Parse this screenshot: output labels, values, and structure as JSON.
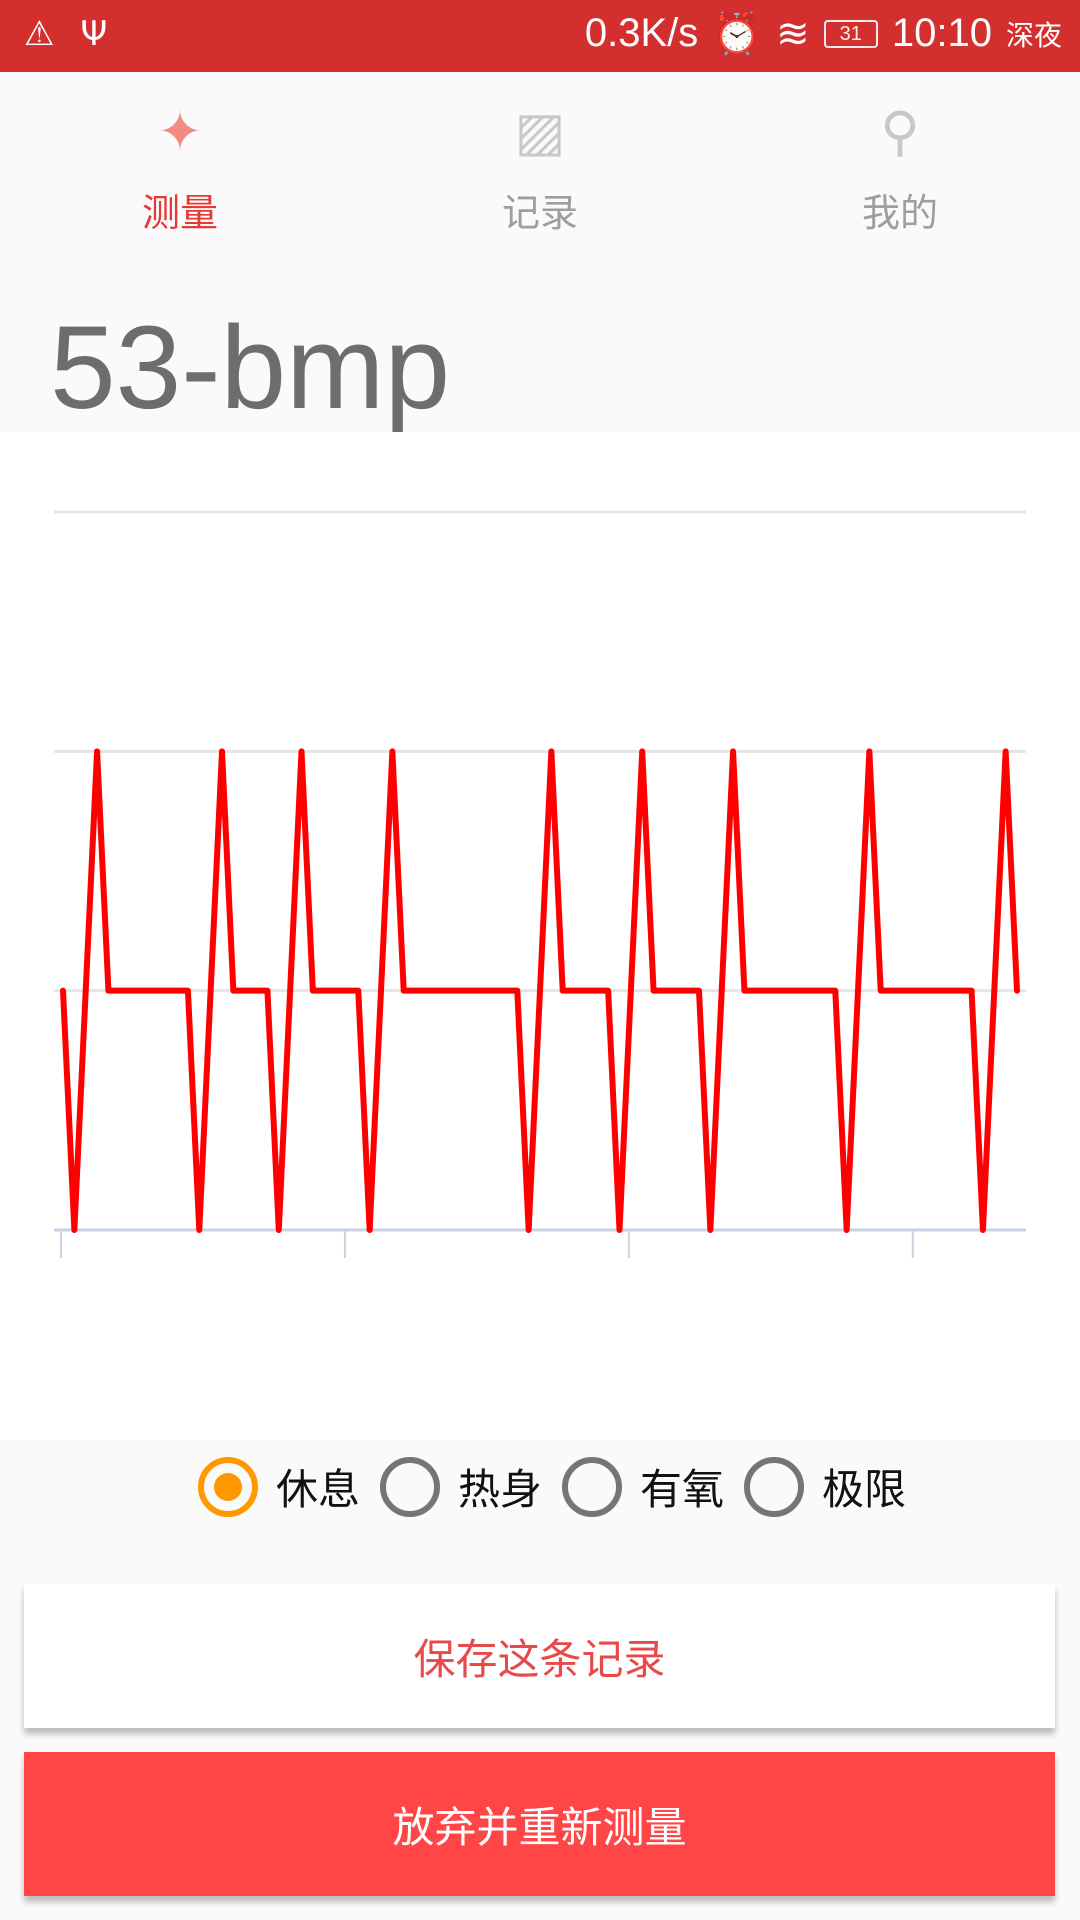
{
  "status_bar": {
    "net_speed": "0.3K/s",
    "battery": "31",
    "time": "10:10",
    "period": "深夜"
  },
  "tabs": [
    {
      "label": "测量",
      "icon": "crosshair-icon"
    },
    {
      "label": "记录",
      "icon": "image-icon"
    },
    {
      "label": "我的",
      "icon": "search-icon"
    }
  ],
  "heart_rate": "53-bmp",
  "chart_data": {
    "type": "line",
    "title": "",
    "xlabel": "",
    "ylabel": "",
    "ylim": [
      0,
      3
    ],
    "xlim": [
      0,
      84
    ],
    "grid": true,
    "x_ticks": [
      0,
      25,
      50,
      75
    ],
    "color": "#ff0000",
    "values": [
      1,
      0,
      1,
      2,
      1,
      1,
      1,
      1,
      1,
      1,
      1,
      1,
      0,
      1,
      2,
      1,
      1,
      1,
      1,
      0,
      1,
      2,
      1,
      1,
      1,
      1,
      1,
      0,
      1,
      2,
      1,
      1,
      1,
      1,
      1,
      1,
      1,
      1,
      1,
      1,
      1,
      0,
      1,
      2,
      1,
      1,
      1,
      1,
      1,
      0,
      1,
      2,
      1,
      1,
      1,
      1,
      1,
      0,
      1,
      2,
      1,
      1,
      1,
      1,
      1,
      1,
      1,
      1,
      1,
      0,
      1,
      2,
      1,
      1,
      1,
      1,
      1,
      1,
      1,
      1,
      1,
      0,
      1,
      2,
      1
    ]
  },
  "modes": [
    {
      "label": "休息",
      "selected": true
    },
    {
      "label": "热身",
      "selected": false
    },
    {
      "label": "有氧",
      "selected": false
    },
    {
      "label": "极限",
      "selected": false
    }
  ],
  "buttons": {
    "save": "保存这条记录",
    "restart": "放弃并重新测量"
  },
  "colors": {
    "status": "#d32f2f",
    "accent": "#e53935",
    "radio": "#ff9800",
    "button": "#ff4545"
  }
}
